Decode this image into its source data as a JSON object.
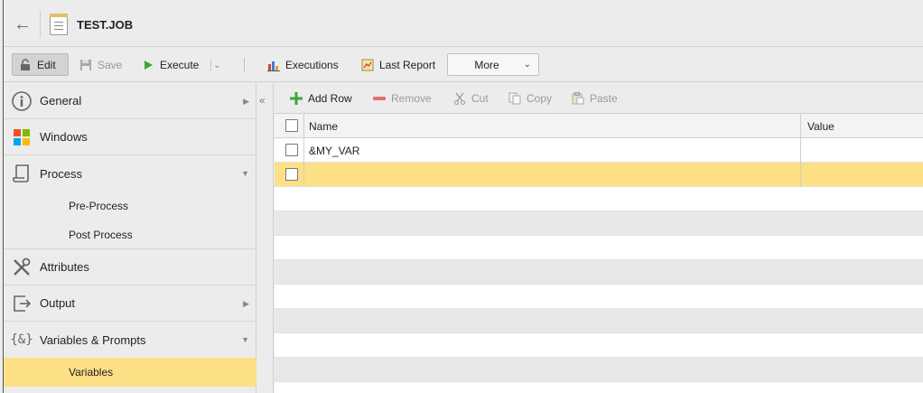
{
  "window": {
    "title": "TEST.JOB"
  },
  "toolbar": {
    "edit_label": "Edit",
    "save_label": "Save",
    "execute_label": "Execute",
    "executions_label": "Executions",
    "last_report_label": "Last Report",
    "more_label": "More"
  },
  "sidebar": {
    "items": [
      {
        "label": "General"
      },
      {
        "label": "Windows"
      },
      {
        "label": "Process"
      },
      {
        "label": "Attributes"
      },
      {
        "label": "Output"
      },
      {
        "label": "Variables & Prompts"
      }
    ],
    "subitems": [
      {
        "label": "Pre-Process"
      },
      {
        "label": "Post Process"
      },
      {
        "label": "Variables"
      }
    ]
  },
  "grid_toolbar": {
    "add_row": "Add Row",
    "remove": "Remove",
    "cut": "Cut",
    "copy": "Copy",
    "paste": "Paste"
  },
  "grid": {
    "columns": [
      "Name",
      "Value"
    ],
    "rows": [
      {
        "name": "&MY_VAR",
        "value": ""
      },
      {
        "name": "",
        "value": ""
      }
    ]
  },
  "colors": {
    "selection": "#fde085",
    "accent_green": "#3aa63a"
  }
}
